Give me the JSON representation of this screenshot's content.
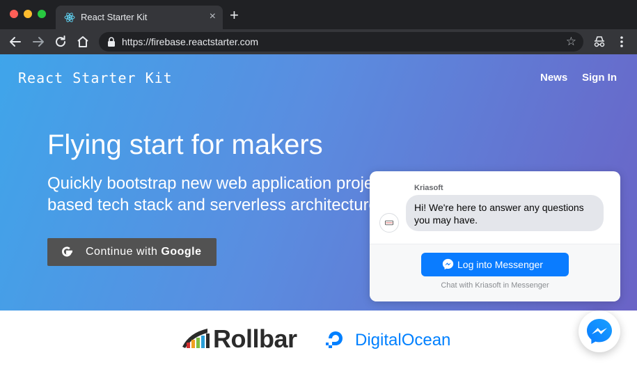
{
  "browser": {
    "tab_title": "React Starter Kit",
    "tab_close": "×",
    "new_tab": "+",
    "url": "https://firebase.reactstarter.com",
    "star": "☆"
  },
  "header": {
    "brand": "React Starter Kit",
    "nav": [
      "News",
      "Sign In"
    ]
  },
  "hero": {
    "headline": "Flying start for makers",
    "subline_1": "Quickly bootstrap new web application proje",
    "subline_2": "based tech stack and serverless architecture",
    "google_button_prefix": "Continue with ",
    "google_button_brand": "Google"
  },
  "sponsors": [
    "Rollbar",
    "DigitalOcean"
  ],
  "messenger": {
    "sender": "Kriasoft",
    "message": "Hi! We're here to answer any questions you may have.",
    "login_button": "Log into Messenger",
    "footer": "Chat with Kriasoft in Messenger"
  },
  "colors": {
    "hero_gradient_start": "#3fa5ea",
    "hero_gradient_end": "#6a63c6",
    "google_button_bg": "#525252",
    "messenger_blue": "#0a7cff",
    "digitalocean_blue": "#0080ff"
  },
  "icons": [
    "react-icon",
    "back-arrow-icon",
    "forward-arrow-icon",
    "reload-icon",
    "home-icon",
    "lock-icon",
    "star-icon",
    "incognito-icon",
    "kebab-menu-icon",
    "google-g-icon",
    "rollbar-logo-icon",
    "digitalocean-logo-icon",
    "messenger-icon"
  ]
}
